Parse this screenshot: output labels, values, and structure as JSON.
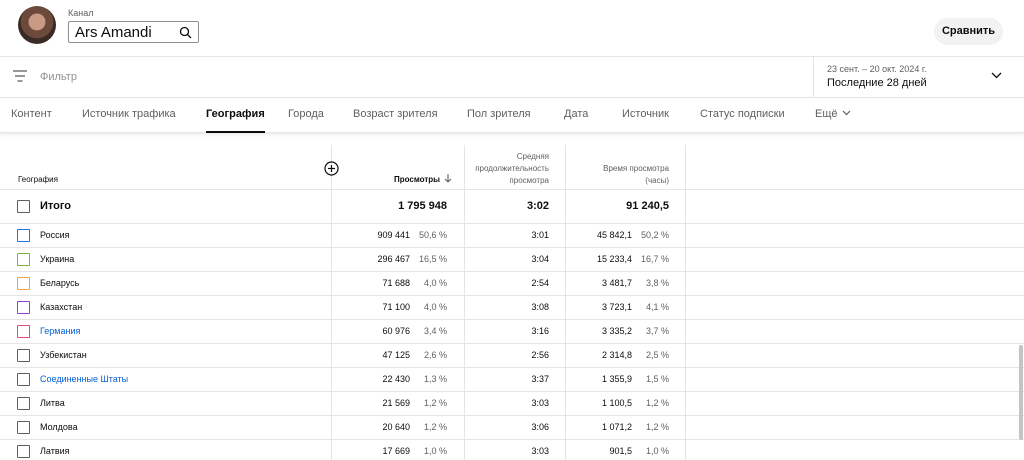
{
  "header": {
    "channel_label": "Канал",
    "channel_name": "Ars Amandi",
    "compare_label": "Сравнить"
  },
  "filter": {
    "placeholder": "Фильтр",
    "date_range": "23 сент. – 20 окт. 2024 г.",
    "period": "Последние 28 дней"
  },
  "tabs": [
    {
      "label": "Контент"
    },
    {
      "label": "Источник трафика"
    },
    {
      "label": "География"
    },
    {
      "label": "Города"
    },
    {
      "label": "Возраст зрителя"
    },
    {
      "label": "Пол зрителя"
    },
    {
      "label": "Дата"
    },
    {
      "label": "Источник"
    },
    {
      "label": "Статус подписки"
    },
    {
      "label": "Ещё"
    }
  ],
  "active_tab": "География",
  "table": {
    "headers": {
      "geo": "География",
      "views": "Просмотры",
      "avg_line1": "Средняя",
      "avg_line2": "продолжительность",
      "avg_line3": "просмотра",
      "time_line1": "Время просмотра",
      "time_line2": "(часы)"
    },
    "total": {
      "label": "Итого",
      "views": "1 795 948",
      "avg": "3:02",
      "time": "91 240,5"
    },
    "rows": [
      {
        "country": "Россия",
        "views": "909 441",
        "views_pct": "50,6 %",
        "avg": "3:01",
        "time": "45 842,1",
        "time_pct": "50,2 %",
        "color": "#1a73e8",
        "link": false
      },
      {
        "country": "Украина",
        "views": "296 467",
        "views_pct": "16,5 %",
        "avg": "3:04",
        "time": "15 233,4",
        "time_pct": "16,7 %",
        "color": "#7cb342",
        "link": false
      },
      {
        "country": "Беларусь",
        "views": "71 688",
        "views_pct": "4,0 %",
        "avg": "2:54",
        "time": "3 481,7",
        "time_pct": "3,8 %",
        "color": "#f2a33a",
        "link": false
      },
      {
        "country": "Казахстан",
        "views": "71 100",
        "views_pct": "4,0 %",
        "avg": "3:08",
        "time": "3 723,1",
        "time_pct": "4,1 %",
        "color": "#8e44cc",
        "link": false
      },
      {
        "country": "Германия",
        "views": "60 976",
        "views_pct": "3,4 %",
        "avg": "3:16",
        "time": "3 335,2",
        "time_pct": "3,7 %",
        "color": "#e8477a",
        "link": true
      },
      {
        "country": "Узбекистан",
        "views": "47 125",
        "views_pct": "2,6 %",
        "avg": "2:56",
        "time": "2 314,8",
        "time_pct": "2,5 %",
        "color": "#606060",
        "link": false
      },
      {
        "country": "Соединенные Штаты",
        "views": "22 430",
        "views_pct": "1,3 %",
        "avg": "3:37",
        "time": "1 355,9",
        "time_pct": "1,5 %",
        "color": "#606060",
        "link": true
      },
      {
        "country": "Литва",
        "views": "21 569",
        "views_pct": "1,2 %",
        "avg": "3:03",
        "time": "1 100,5",
        "time_pct": "1,2 %",
        "color": "#606060",
        "link": false
      },
      {
        "country": "Молдова",
        "views": "20 640",
        "views_pct": "1,2 %",
        "avg": "3:06",
        "time": "1 071,2",
        "time_pct": "1,2 %",
        "color": "#606060",
        "link": false
      },
      {
        "country": "Латвия",
        "views": "17 669",
        "views_pct": "1,0 %",
        "avg": "3:03",
        "time": "901,5",
        "time_pct": "1,0 %",
        "color": "#606060",
        "link": false
      }
    ]
  },
  "icons": {
    "search": "search-icon",
    "filter": "filter-icon",
    "dropdown": "chevron-down-icon",
    "add_column": "add-circle-icon",
    "sort": "arrow-down-icon"
  }
}
